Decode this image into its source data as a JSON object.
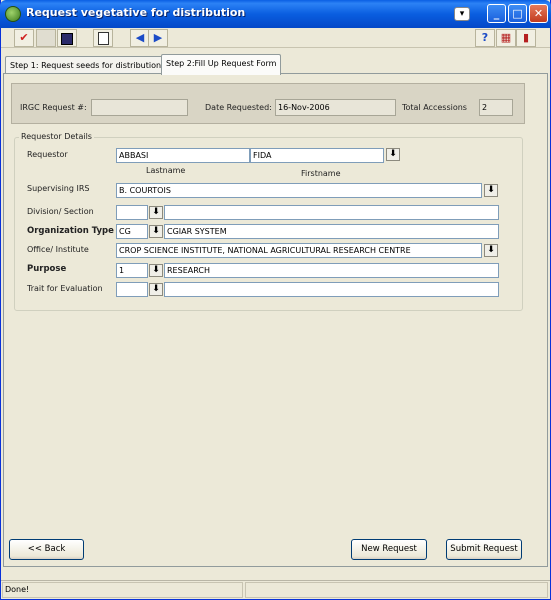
{
  "window": {
    "title": "Request vegetative for distribution"
  },
  "toolbar": {
    "icons": [
      "check-icon",
      "blank-icon",
      "save-icon",
      "clipboard-icon",
      "previous-icon",
      "next-icon",
      "help-icon",
      "print-icon",
      "exit-icon"
    ]
  },
  "tabs": [
    {
      "label": "Step 1: Request seeds for distribution",
      "selected": false
    },
    {
      "label": "Step 2:Fill Up Request Form",
      "selected": true
    }
  ],
  "header": {
    "irgc_label": "IRGC Request #:",
    "irgc_value": "",
    "date_label": "Date Requested:",
    "date_value": "16-Nov-2006",
    "total_label": "Total Accessions",
    "total_value": "2"
  },
  "requestor": {
    "group_title": "Requestor Details",
    "requestor_label": "Requestor",
    "lastname": "ABBASI",
    "firstname": "FIDA",
    "lastname_caption": "Lastname",
    "firstname_caption": "Firstname",
    "supervising_label": "Supervising IRS",
    "supervising_value": "B. COURTOIS",
    "division_label": "Division/ Section",
    "division_code": "",
    "division_value": "",
    "org_type_label": "Organization Type",
    "org_type_code": "CG",
    "org_type_value": "CGIAR SYSTEM",
    "office_label": "Office/ Institute",
    "office_value": "CROP SCIENCE INSTITUTE, NATIONAL AGRICULTURAL RESEARCH CENTRE",
    "purpose_label": "Purpose",
    "purpose_code": "1",
    "purpose_value": "RESEARCH",
    "trait_label": "Trait for Evaluation",
    "trait_code": "",
    "trait_value": ""
  },
  "buttons": {
    "back": "<< Back",
    "new_request": "New Request",
    "submit_request": "Submit Request"
  },
  "status": {
    "text": "Done!"
  },
  "colors": {
    "title_bar": "#0A5EE0",
    "face": "#ECE9D8"
  }
}
